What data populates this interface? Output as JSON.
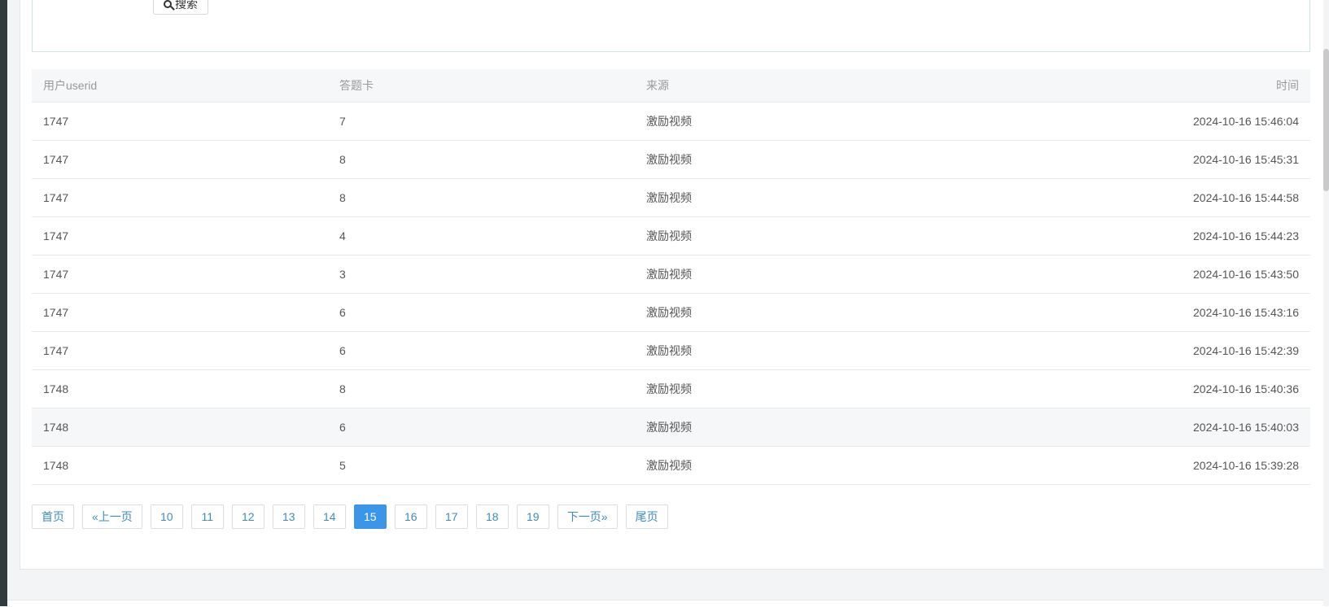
{
  "search": {
    "button_label": "搜索"
  },
  "table": {
    "headers": {
      "user": "用户userid",
      "card": "答题卡",
      "source": "来源",
      "time": "时间"
    },
    "rows": [
      {
        "user": "1747",
        "card": "7",
        "source": "激励视频",
        "time": "2024-10-16 15:46:04"
      },
      {
        "user": "1747",
        "card": "8",
        "source": "激励视频",
        "time": "2024-10-16 15:45:31"
      },
      {
        "user": "1747",
        "card": "8",
        "source": "激励视频",
        "time": "2024-10-16 15:44:58"
      },
      {
        "user": "1747",
        "card": "4",
        "source": "激励视频",
        "time": "2024-10-16 15:44:23"
      },
      {
        "user": "1747",
        "card": "3",
        "source": "激励视频",
        "time": "2024-10-16 15:43:50"
      },
      {
        "user": "1747",
        "card": "6",
        "source": "激励视频",
        "time": "2024-10-16 15:43:16"
      },
      {
        "user": "1747",
        "card": "6",
        "source": "激励视频",
        "time": "2024-10-16 15:42:39"
      },
      {
        "user": "1748",
        "card": "8",
        "source": "激励视频",
        "time": "2024-10-16 15:40:36"
      },
      {
        "user": "1748",
        "card": "6",
        "source": "激励视频",
        "time": "2024-10-16 15:40:03"
      },
      {
        "user": "1748",
        "card": "5",
        "source": "激励视频",
        "time": "2024-10-16 15:39:28"
      }
    ]
  },
  "pagination": {
    "first": "首页",
    "prev": "«上一页",
    "pages": [
      "10",
      "11",
      "12",
      "13",
      "14",
      "15",
      "16",
      "17",
      "18",
      "19"
    ],
    "current": "15",
    "next": "下一页»",
    "last": "尾页"
  },
  "colors": {
    "accent": "#3b95e8",
    "link": "#3c8dbc"
  }
}
